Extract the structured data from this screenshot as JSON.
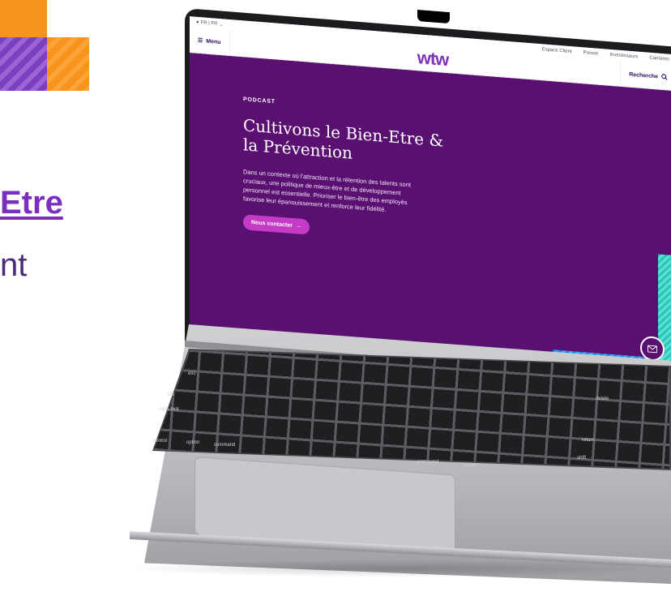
{
  "slide": {
    "link_text": "Etre",
    "sub_text": "nt"
  },
  "site": {
    "locale": "FR | FR",
    "utility_links": [
      "Espace Client",
      "Presse",
      "Investisseurs",
      "Carrières"
    ],
    "menu_label": "Menu",
    "logo": "wtw",
    "search_label": "Recherche",
    "colors": {
      "brand_purple": "#7f35b2",
      "hero_bg": "#5a1070",
      "cta": "#c63bc6"
    }
  },
  "hero": {
    "eyebrow": "PODCAST",
    "title_line1": "Cultivons le Bien-Etre &",
    "title_line2": "la Prévention",
    "desc_line1": "Dans un contexte où l'attraction et la rétention des talents sont",
    "desc_line2": "cruciaux, une politique de mieux-être et de développement",
    "desc_line3": "personnel est essentielle. Prioriser le bien-être des employés",
    "desc_line4": "favorise leur épanouissement et renforce leur fidélité.",
    "cta_label": "Nous contacter"
  },
  "keyboard": {
    "labels": [
      "esc",
      "delete",
      "tab",
      "caps lock",
      "return",
      "shift",
      "control",
      "option",
      "command",
      "command",
      "option"
    ]
  }
}
